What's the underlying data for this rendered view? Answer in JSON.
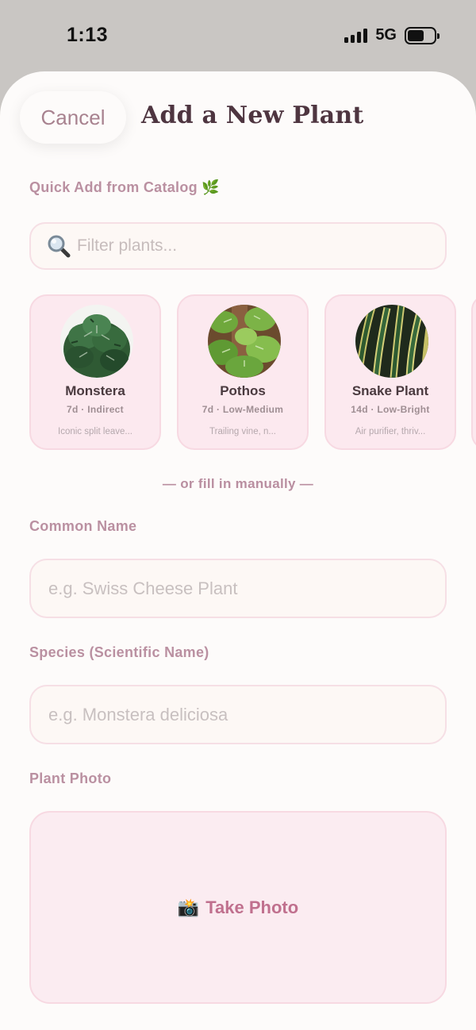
{
  "status": {
    "time": "1:13",
    "network": "5G",
    "battery_level": 0.64
  },
  "header": {
    "cancel_label": "Cancel",
    "title": "Add a New Plant"
  },
  "catalog": {
    "section_label": "Quick Add from Catalog 🌿",
    "search_placeholder": "Filter plants...",
    "search_icon": "🔍",
    "plants": [
      {
        "name": "Monstera",
        "meta": "7d · Indirect",
        "desc": "Iconic split leave..."
      },
      {
        "name": "Pothos",
        "meta": "7d · Low-Medium",
        "desc": "Trailing vine, n..."
      },
      {
        "name": "Snake Plant",
        "meta": "14d · Low-Bright",
        "desc": "Air purifier, thriv..."
      }
    ]
  },
  "divider": "— or fill in manually —",
  "form": {
    "common_name_label": "Common Name",
    "common_name_placeholder": "e.g. Swiss Cheese Plant",
    "species_label": "Species (Scientific Name)",
    "species_placeholder": "e.g. Monstera deliciosa",
    "photo_label": "Plant Photo",
    "take_photo_icon": "📸",
    "take_photo_label": "Take Photo"
  },
  "colors": {
    "accent": "#c0708e",
    "label": "#ba90a1",
    "card_bg": "#fce9ef",
    "title": "#4e3540"
  }
}
